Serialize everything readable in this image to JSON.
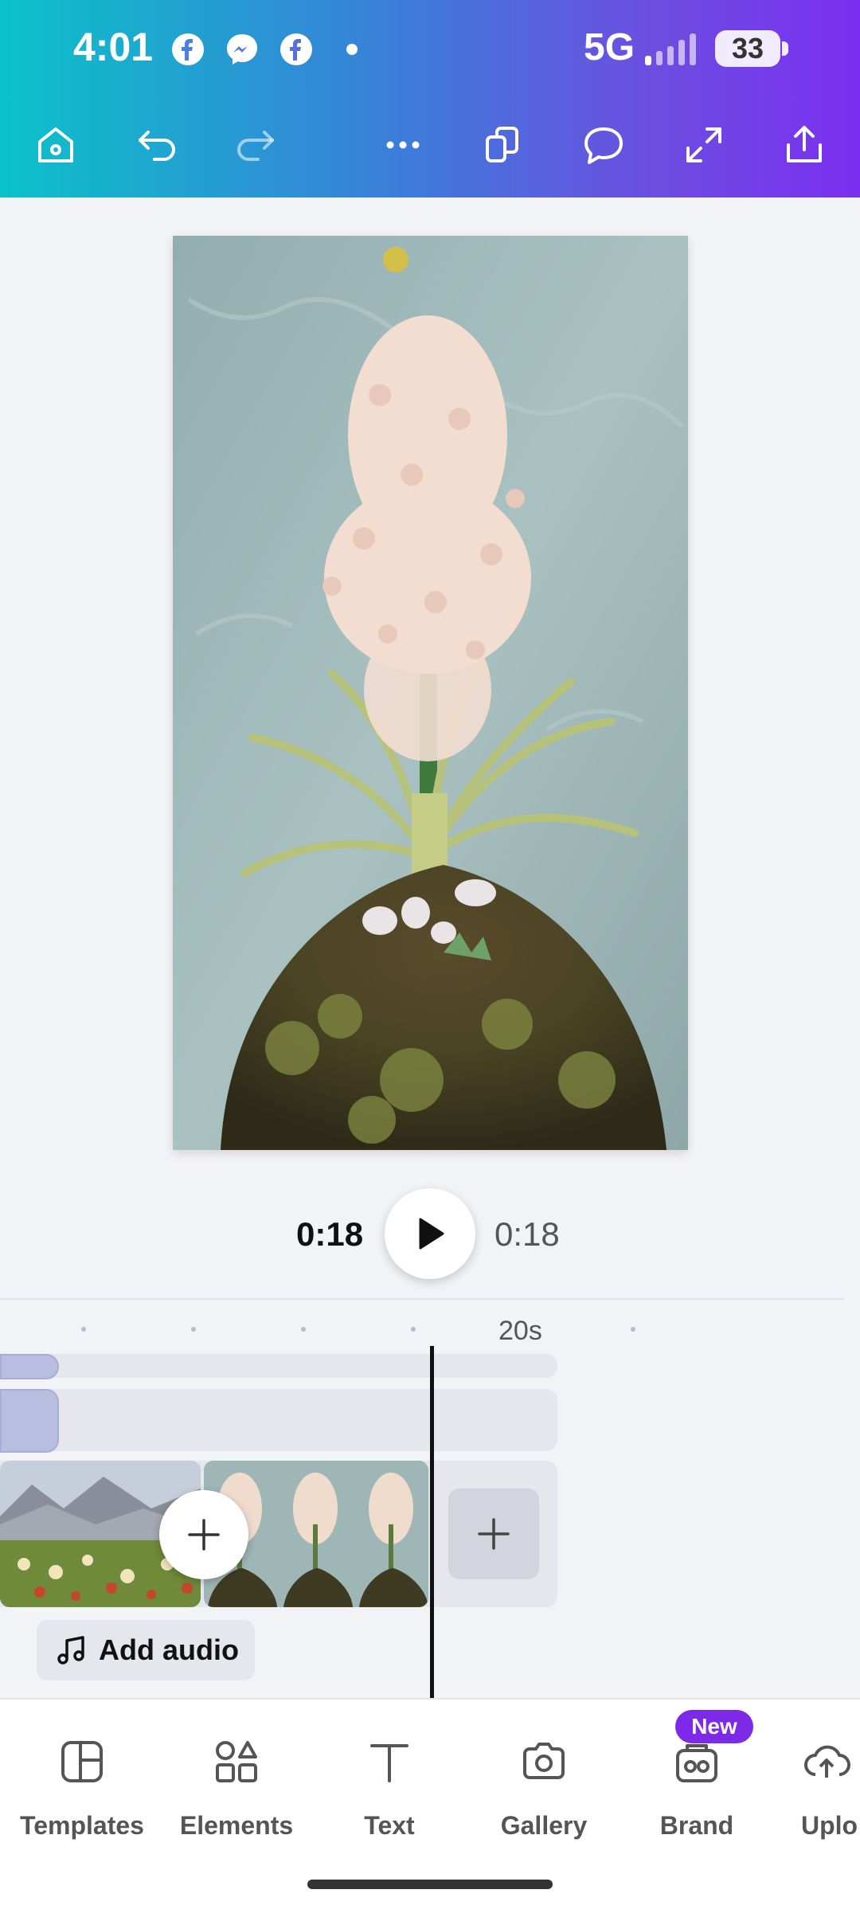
{
  "status_bar": {
    "time": "4:01",
    "network": "5G",
    "battery": "33",
    "icons": [
      "facebook-icon",
      "messenger-icon",
      "facebook-icon",
      "notification-dot-icon",
      "signal-icon"
    ]
  },
  "toolbar": {
    "buttons": [
      "home-icon",
      "undo-icon",
      "redo-icon",
      "more-icon",
      "duplicate-icon",
      "comment-icon",
      "expand-icon",
      "share-icon"
    ]
  },
  "player": {
    "current_time": "0:18",
    "total_time": "0:18"
  },
  "timeline": {
    "ruler_label": "20s"
  },
  "audio": {
    "add_label": "Add audio"
  },
  "nav": {
    "items": [
      {
        "label": "Templates",
        "icon": "templates-icon"
      },
      {
        "label": "Elements",
        "icon": "elements-icon"
      },
      {
        "label": "Text",
        "icon": "text-icon"
      },
      {
        "label": "Gallery",
        "icon": "camera-icon"
      },
      {
        "label": "Brand",
        "icon": "brand-icon"
      },
      {
        "label": "Uplo",
        "icon": "upload-icon"
      }
    ],
    "badge": "New"
  },
  "colors": {
    "header_gradient_start": "#0bc2c9",
    "header_gradient_end": "#7b2ff0",
    "accent": "#7d2ae8"
  }
}
